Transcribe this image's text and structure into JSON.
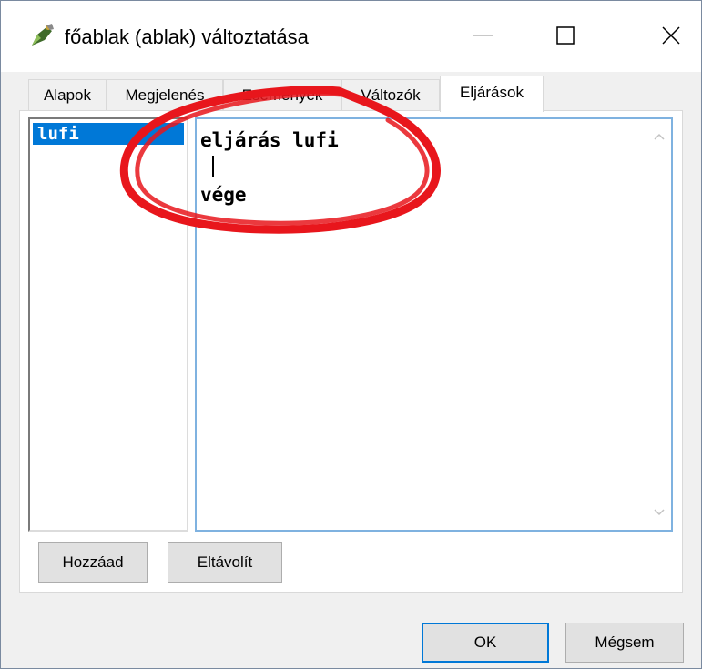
{
  "window": {
    "title": "főablak (ablak) változtatása",
    "app_icon": "pencil-brush-icon"
  },
  "tabs": [
    {
      "label": "Alapok",
      "active": false
    },
    {
      "label": "Megjelenés",
      "active": false
    },
    {
      "label": "Események",
      "active": false
    },
    {
      "label": "Változók",
      "active": false
    },
    {
      "label": "Eljárások",
      "active": true
    }
  ],
  "procedures": {
    "items": [
      "lufi"
    ],
    "selected": "lufi"
  },
  "editor": {
    "lines": [
      "eljárás lufi",
      "",
      "vége"
    ]
  },
  "buttons": {
    "add": "Hozzáad",
    "remove": "Eltávolít",
    "ok": "OK",
    "cancel": "Mégsem"
  },
  "colors": {
    "selection": "#0078d7",
    "annotation": "#e8161c",
    "editor_border": "#7fb2e0"
  }
}
